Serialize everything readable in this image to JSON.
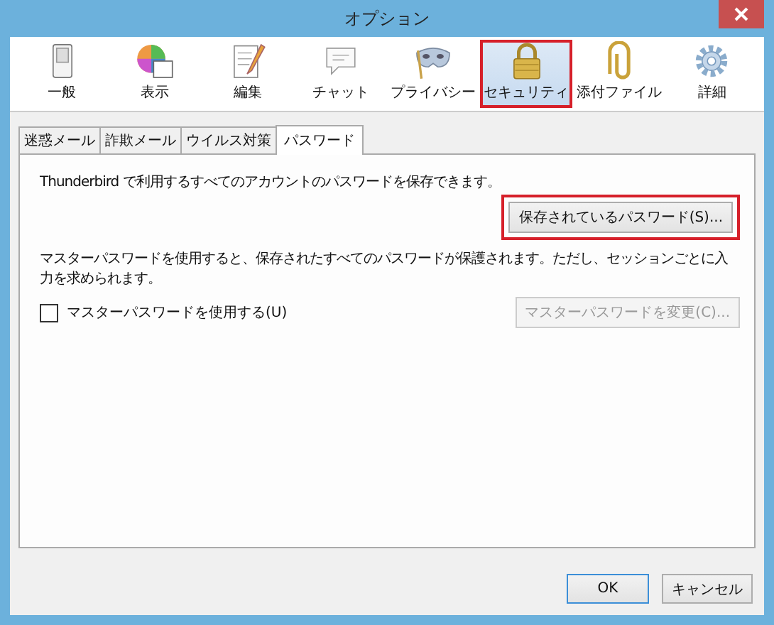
{
  "window": {
    "title": "オプション"
  },
  "toolbar": [
    {
      "label": "一般",
      "selected": false,
      "highlighted": false
    },
    {
      "label": "表示",
      "selected": false,
      "highlighted": false
    },
    {
      "label": "編集",
      "selected": false,
      "highlighted": false
    },
    {
      "label": "チャット",
      "selected": false,
      "highlighted": false
    },
    {
      "label": "プライバシー",
      "selected": false,
      "highlighted": false
    },
    {
      "label": "セキュリティ",
      "selected": true,
      "highlighted": true
    },
    {
      "label": "添付ファイル",
      "selected": false,
      "highlighted": false
    },
    {
      "label": "詳細",
      "selected": false,
      "highlighted": false
    }
  ],
  "tabs": [
    {
      "label": "迷惑メール",
      "selected": false
    },
    {
      "label": "詐欺メール",
      "selected": false
    },
    {
      "label": "ウイルス対策",
      "selected": false
    },
    {
      "label": "パスワード",
      "selected": true
    }
  ],
  "panel": {
    "intro": "Thunderbird で利用するすべてのアカウントのパスワードを保存できます。",
    "saved_button": {
      "label": "保存されているパスワード(S)...",
      "highlighted": true,
      "disabled": false
    },
    "master_text": "マスターパスワードを使用すると、保存されたすべてのパスワードが保護されます。ただし、セッションごとに入力を求められます。",
    "master_checkbox": {
      "label": "マスターパスワードを使用する(U)",
      "checked": false
    },
    "change_button": {
      "label": "マスターパスワードを変更(C)...",
      "disabled": true
    }
  },
  "buttons": [
    {
      "label": "OK",
      "default": true
    },
    {
      "label": "キャンセル",
      "default": false
    }
  ]
}
